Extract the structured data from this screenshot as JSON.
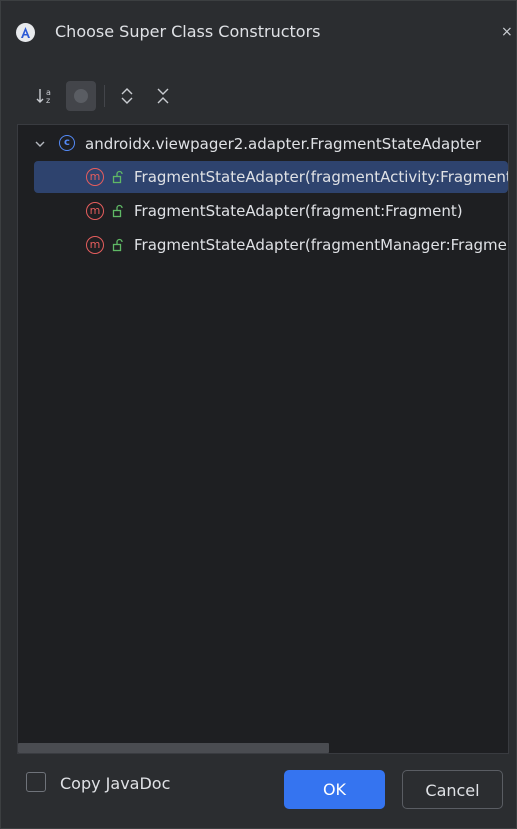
{
  "window": {
    "title": "Choose Super Class Constructors",
    "close": "×"
  },
  "toolbar": {
    "sort_icon": "sort-alpha-icon",
    "toggle_icon": "circle-toggle-icon",
    "expand_icon": "expand-all-icon",
    "collapse_icon": "collapse-all-icon"
  },
  "tree": {
    "root": {
      "icon": "class-icon",
      "icon_letter": "c",
      "label": "androidx.viewpager2.adapter.FragmentStateAdapter"
    },
    "items": [
      {
        "icon_letter": "m",
        "label": "FragmentStateAdapter(fragmentActivity:FragmentActivity)",
        "selected": true
      },
      {
        "icon_letter": "m",
        "label": "FragmentStateAdapter(fragment:Fragment)",
        "selected": false
      },
      {
        "icon_letter": "m",
        "label": "FragmentStateAdapter(fragmentManager:FragmentManager, lifecycle:Lifecycle)",
        "selected": false
      }
    ]
  },
  "footer": {
    "copy_javadoc_label": "Copy JavaDoc",
    "copy_javadoc_checked": false,
    "ok_label": "OK",
    "cancel_label": "Cancel"
  },
  "colors": {
    "background": "#2b2d30",
    "tree_background": "#1e1f22",
    "selection": "#2e436e",
    "accent": "#3574f0",
    "class_icon": "#548af7",
    "method_icon": "#e55d5d",
    "public_lock": "#5fb865"
  }
}
